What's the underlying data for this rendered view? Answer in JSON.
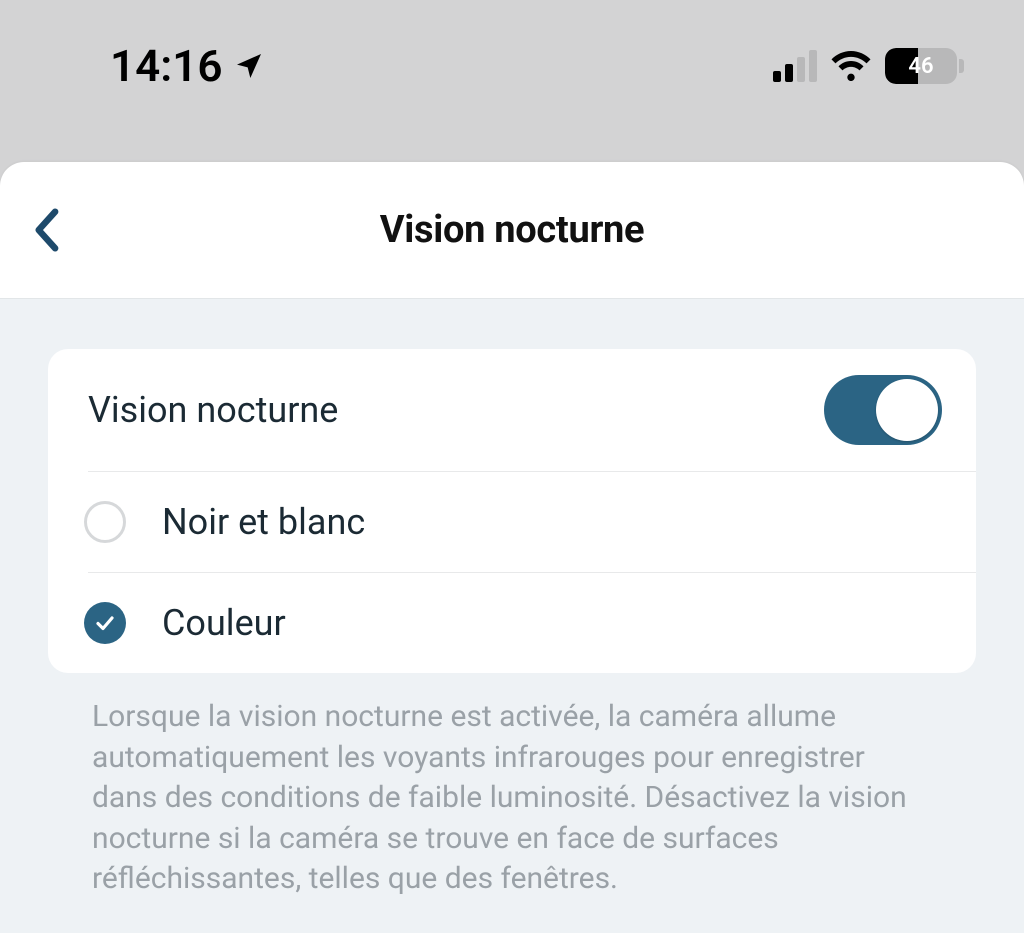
{
  "status_bar": {
    "time": "14:16",
    "battery_percent": "46"
  },
  "header": {
    "title": "Vision nocturne"
  },
  "settings": {
    "toggle_label": "Vision nocturne",
    "option_bw": "Noir et blanc",
    "option_color": "Couleur"
  },
  "help": "Lorsque la vision nocturne est activée, la caméra allume automatiquement les voyants infrarouges pour enregistrer dans des conditions de faible luminosité. Désactivez la vision nocturne si la caméra se trouve en face de surfaces réfléchissantes, telles que des fenêtres."
}
